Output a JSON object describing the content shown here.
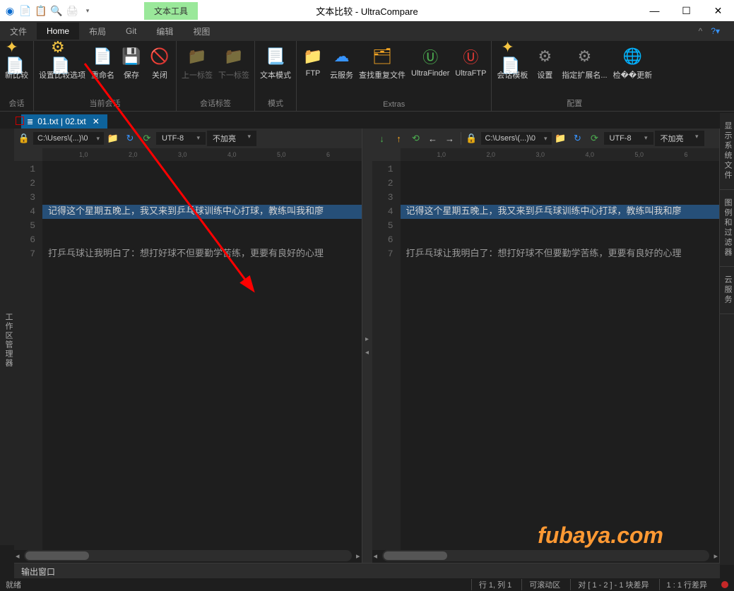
{
  "title": "文本比较 - UltraCompare",
  "tool_tab": "文本工具",
  "menu": {
    "file": "文件",
    "home": "Home",
    "layout": "布局",
    "git": "Git",
    "edit": "编辑",
    "view": "视图"
  },
  "ribbon": {
    "g1": {
      "new": "新比较",
      "label": "会话"
    },
    "g2": {
      "opts": "设置比较选项",
      "rename": "重命名",
      "save": "保存",
      "close": "关闭",
      "label": "当前会话"
    },
    "g3": {
      "prev": "上一标签",
      "next": "下一标签",
      "label": "会话标签"
    },
    "g4": {
      "mode": "文本模式",
      "label": "模式"
    },
    "g5": {
      "ftp": "FTP",
      "cloud": "云服务",
      "dup": "查找重复文件",
      "uf": "UltraFinder",
      "uftp": "UltraFTP",
      "label": "Extras"
    },
    "g6": {
      "tpl": "会话模板",
      "settings": "设置",
      "ext": "指定扩展名...",
      "upd": "检��更新",
      "label": "配置"
    }
  },
  "tab": {
    "title": "01.txt | 02.txt"
  },
  "pane": {
    "path": "C:\\Users\\(...)\\0",
    "encoding": "UTF-8",
    "highlight": "不加亮",
    "ruler": [
      "1,0",
      "2,0",
      "3,0",
      "4,0",
      "5,0",
      "6"
    ],
    "lines": [
      "1",
      "2",
      "3",
      "4",
      "5",
      "6",
      "7"
    ],
    "row4": "记得这个星期五晚上，我又来到乒乓球训练中心打球，教练叫我和廖",
    "row4b": "记得这个星期五晚上，我又来到乒乓球训练中心打球，教练叫我和廖",
    "row7": "打乒乓球让我明白了：想打好球不但要勤学苦练，更要有良好的心理",
    "row7b": "打乒乓球让我明白了：想打好球不但要勤学苦练，更要有良好的心理"
  },
  "left_panel": "工作区管理器",
  "right_panels": {
    "p1": "显示系统文件",
    "p2": "图例和过滤器",
    "p3": "云服务"
  },
  "output": "输出窗口",
  "status": {
    "ready": "就绪",
    "pos": "行 1, 列 1",
    "scroll": "可滚动区",
    "diff": "对 [ 1 - 2 ] - 1 块差异",
    "line": "1 : 1 行差异"
  },
  "watermark": "fubaya.com"
}
